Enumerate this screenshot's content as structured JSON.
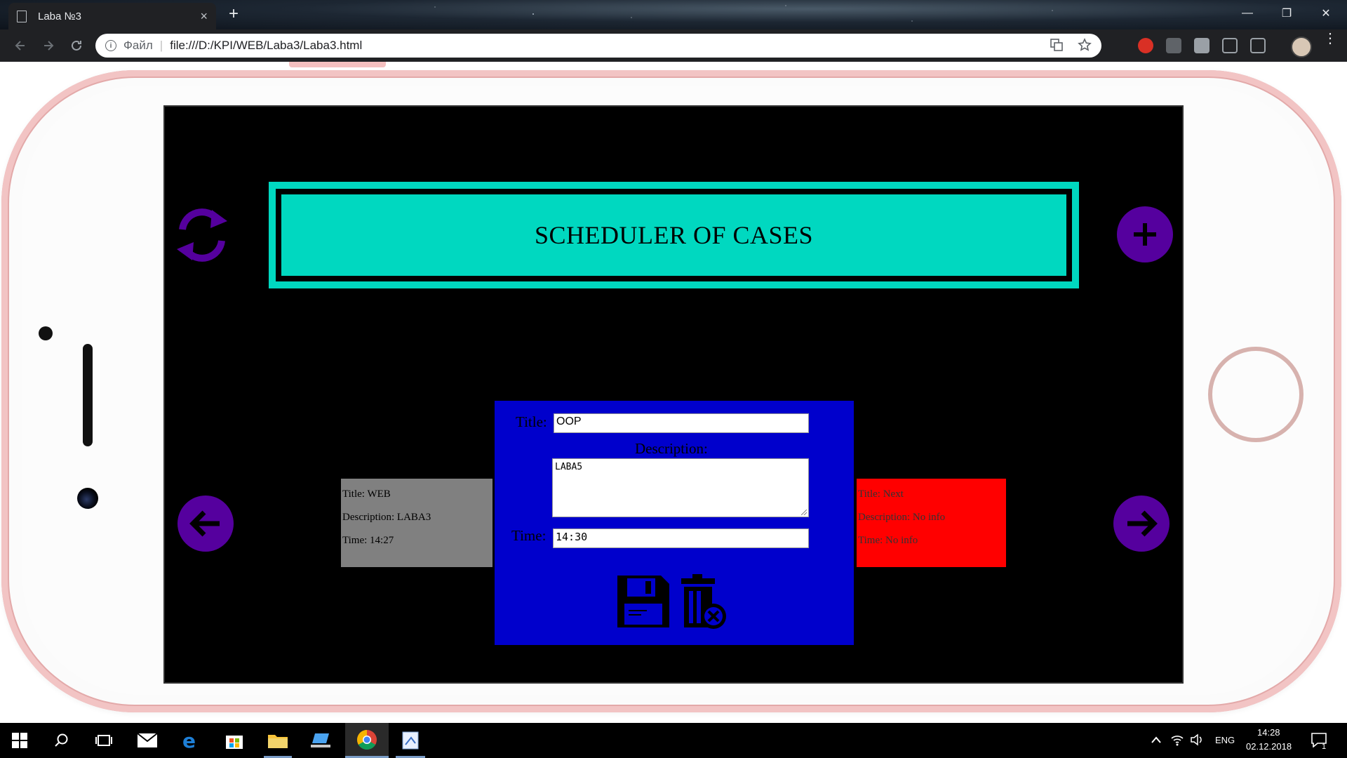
{
  "browser": {
    "tab_title": "Laba №3",
    "tab_close": "×",
    "new_tab": "+",
    "scheme_label": "Файл",
    "url": "file:///D:/KPI/WEB/Laba3/Laba3.html",
    "window_controls": [
      "—",
      "❐",
      "✕"
    ]
  },
  "app": {
    "header_title": "SCHEDULER OF CASES",
    "accent_color": "#00d8c0",
    "button_color": "#55009e"
  },
  "prev_card": {
    "title": "Title: WEB",
    "description": "Description: LABA3",
    "time": "Time: 14:27",
    "color": "#808080"
  },
  "next_card": {
    "title": "Title: Next",
    "description": "Description: No info",
    "time": "Time: No info",
    "color": "#ff0000"
  },
  "editor": {
    "title_label": "Title:",
    "title_value": "OOP",
    "description_label": "Description:",
    "description_value": "LABA5",
    "time_label": "Time:",
    "time_value": "14:30",
    "color": "#0000cc"
  },
  "taskbar": {
    "language": "ENG",
    "time": "14:28",
    "date": "02.12.2018",
    "notification_count": "1"
  }
}
